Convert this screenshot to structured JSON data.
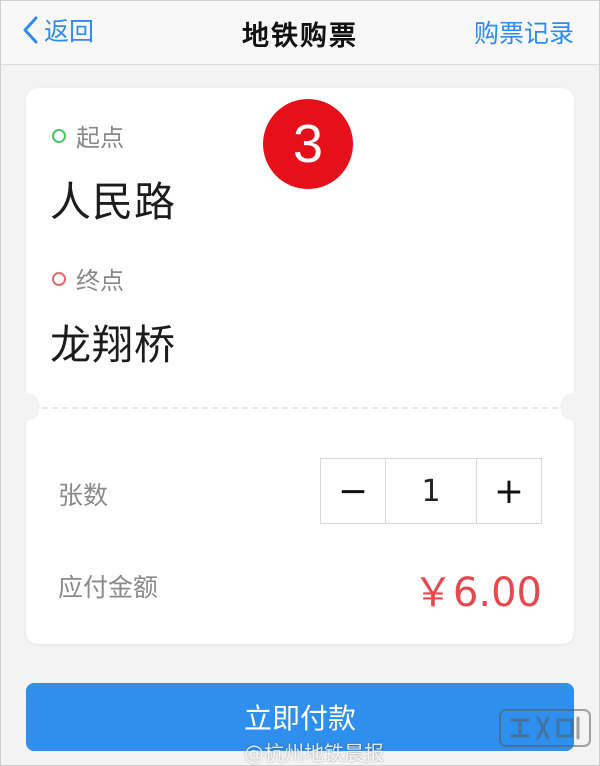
{
  "header": {
    "back_label": "返回",
    "title": "地铁购票",
    "history_label": "购票记录"
  },
  "trip": {
    "origin_label": "起点",
    "origin": "人民路",
    "destination_label": "终点",
    "destination": "龙翔桥"
  },
  "step_badge": "3",
  "quantity": {
    "label": "张数",
    "value": "1",
    "minus": "−",
    "plus": "+"
  },
  "payment": {
    "label": "应付金额",
    "amount": "￥6.00",
    "button_label": "立即付款"
  },
  "watermark": {
    "text": "@杭州地铁晨报"
  },
  "colors": {
    "accent": "#2f8fee",
    "badge": "#e5101a",
    "price": "#e8484d",
    "origin_dot": "#4ac46a",
    "destination_dot": "#e26b6b"
  }
}
